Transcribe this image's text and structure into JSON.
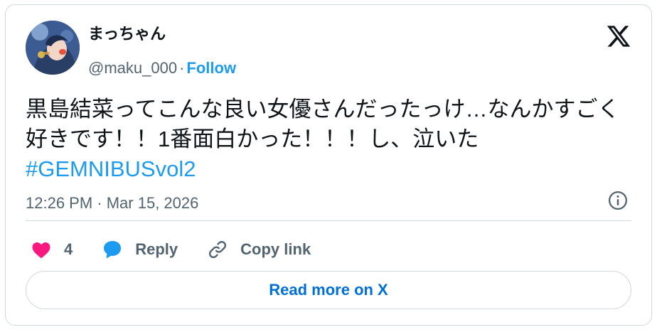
{
  "author": {
    "display_name": "まっちゃん",
    "handle": "@maku_000",
    "separator": "·",
    "follow_label": "Follow"
  },
  "tweet": {
    "text": "黒島結菜ってこんな良い女優さんだったっけ…なんかすごく好きです！！1番面白かった！！！し、泣いた",
    "hashtag": "#GEMNIBUSvol2",
    "timestamp": "12:26 PM · Mar 15, 2026"
  },
  "actions": {
    "like_count": "4",
    "reply_label": "Reply",
    "copy_link_label": "Copy link"
  },
  "read_more_label": "Read more on X",
  "icons": {
    "logo": "x-logo-icon",
    "info": "info-icon",
    "like": "heart-icon",
    "reply": "speech-bubble-icon",
    "copy": "link-icon"
  },
  "colors": {
    "accent": "#1d9bf0",
    "like": "#f91880",
    "text_primary": "#0f1419",
    "text_secondary": "#536471",
    "border": "#cfd9de"
  }
}
